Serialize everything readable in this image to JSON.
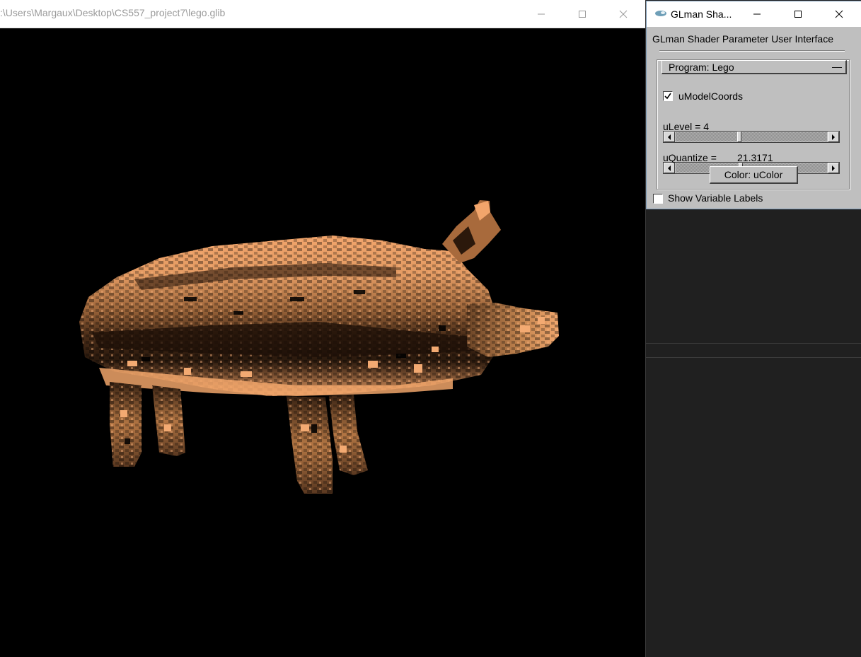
{
  "main_window": {
    "title": ":\\Users\\Margaux\\Desktop\\CS557_project7\\lego.glib",
    "minimize_icon": "minimize-icon",
    "maximize_icon": "maximize-icon",
    "close_icon": "close-icon",
    "render_subject": "lego-shaded-pig-model",
    "model_color": "#f0a46a"
  },
  "glui_window": {
    "title": "GLman Sha...",
    "app_icon": "glman-app-icon",
    "heading": "GLman Shader Parameter User Interface",
    "program_rollout": {
      "label": "Program: Lego",
      "collapse_glyph": "—"
    },
    "model_coords": {
      "label": "uModelCoords",
      "checked": true
    },
    "level": {
      "label": "uLevel = 4",
      "value": 4
    },
    "quantize": {
      "label": "uQuantize =",
      "value_text": "21.3171",
      "value": 21.3171
    },
    "color_button": {
      "label": "Color: uColor"
    },
    "show_labels": {
      "label": "Show Variable Labels",
      "checked": false
    }
  },
  "colors": {
    "viewport_background": "#000000",
    "panel_background": "#bfbfbf",
    "desktop_background": "#202020"
  }
}
